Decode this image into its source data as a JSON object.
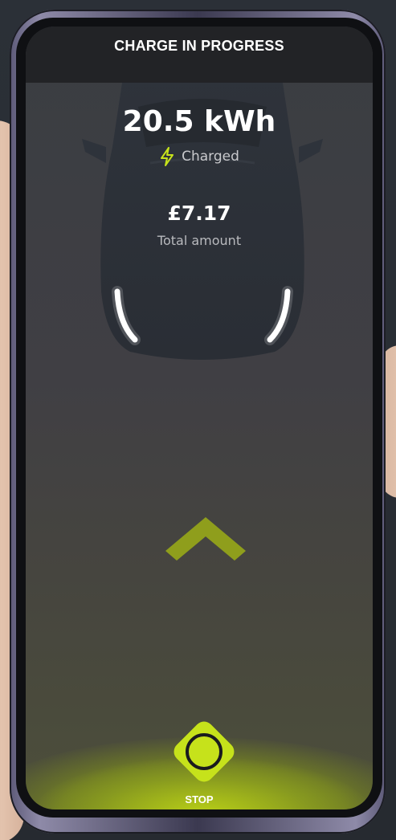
{
  "header": {
    "title": "CHARGE IN PROGRESS"
  },
  "session": {
    "energy": "20.5 kWh",
    "energy_status": "Charged",
    "amount": "£7.17",
    "amount_label": "Total amount"
  },
  "actions": {
    "swipe_icon": "chevron-up-icon",
    "stop_label": "STOP",
    "stop_icon": "circle-icon"
  },
  "colors": {
    "accent": "#c6e21b",
    "header_bg": "#222326",
    "screen_bg": "#3f3f43"
  }
}
